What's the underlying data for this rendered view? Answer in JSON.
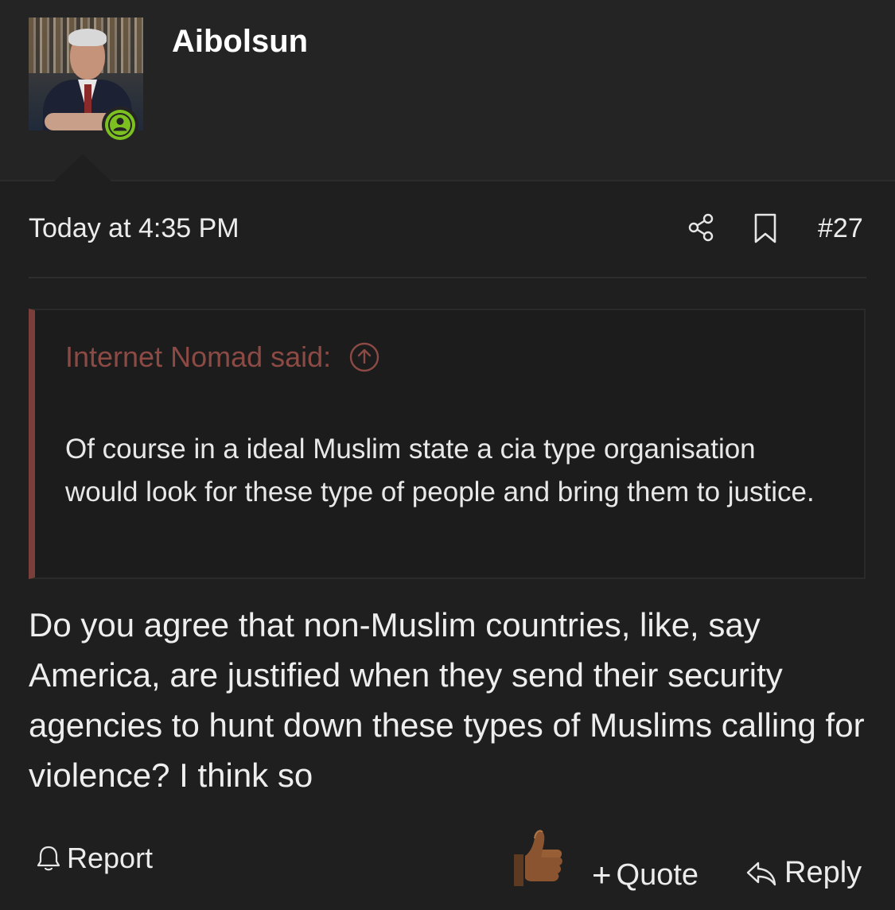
{
  "author": {
    "username": "Aibolsun",
    "status_color": "#7cc11f"
  },
  "post": {
    "timestamp": "Today at 4:35 PM",
    "number": "#27",
    "body": "Do you agree that non-Muslim countries, like, say America, are justified when they send their security agencies to hunt down these types of Muslims calling for violence? I think so"
  },
  "quote": {
    "attribution": "Internet Nomad said:",
    "text": "Of course in a ideal Muslim state a cia type organisation would look for these type of people and bring them to justice.",
    "accent_color": "#7b3f3b"
  },
  "actions": {
    "report_label": "Report",
    "quote_label": "Quote",
    "quote_prefix": "+",
    "reply_label": "Reply"
  },
  "icons": {
    "share": "share-icon",
    "bookmark": "bookmark-icon",
    "jump_to_quote": "arrow-up-circle-icon",
    "report": "bell-icon",
    "reaction": "thumbs-up-icon",
    "reply": "reply-icon"
  }
}
